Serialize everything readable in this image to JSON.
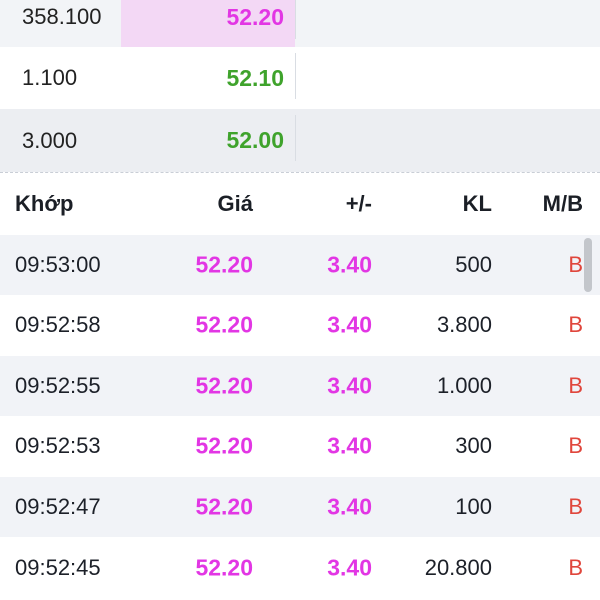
{
  "order_book": [
    {
      "volume": "358.100",
      "price": "52.20",
      "price_color": "#e236e4",
      "highlighted": true
    },
    {
      "volume": "1.100",
      "price": "52.10",
      "price_color": "#3fa32c",
      "highlighted": false
    },
    {
      "volume": "3.000",
      "price": "52.00",
      "price_color": "#3fa32c",
      "highlighted": false
    }
  ],
  "trades_header": {
    "time": "Khớp",
    "price": "Giá",
    "change": "+/-",
    "volume": "KL",
    "side": "M/B"
  },
  "trades": [
    {
      "time": "09:53:00",
      "price": "52.20",
      "change": "3.40",
      "volume": "500",
      "side": "B"
    },
    {
      "time": "09:52:58",
      "price": "52.20",
      "change": "3.40",
      "volume": "3.800",
      "side": "B"
    },
    {
      "time": "09:52:55",
      "price": "52.20",
      "change": "3.40",
      "volume": "1.000",
      "side": "B"
    },
    {
      "time": "09:52:53",
      "price": "52.20",
      "change": "3.40",
      "volume": "300",
      "side": "B"
    },
    {
      "time": "09:52:47",
      "price": "52.20",
      "change": "3.40",
      "volume": "100",
      "side": "B"
    },
    {
      "time": "09:52:45",
      "price": "52.20",
      "change": "3.40",
      "volume": "20.800",
      "side": "B"
    }
  ],
  "colors": {
    "ceiling_up": "#e236e4",
    "up": "#3fa32c",
    "buy_side": "#e0463c"
  }
}
